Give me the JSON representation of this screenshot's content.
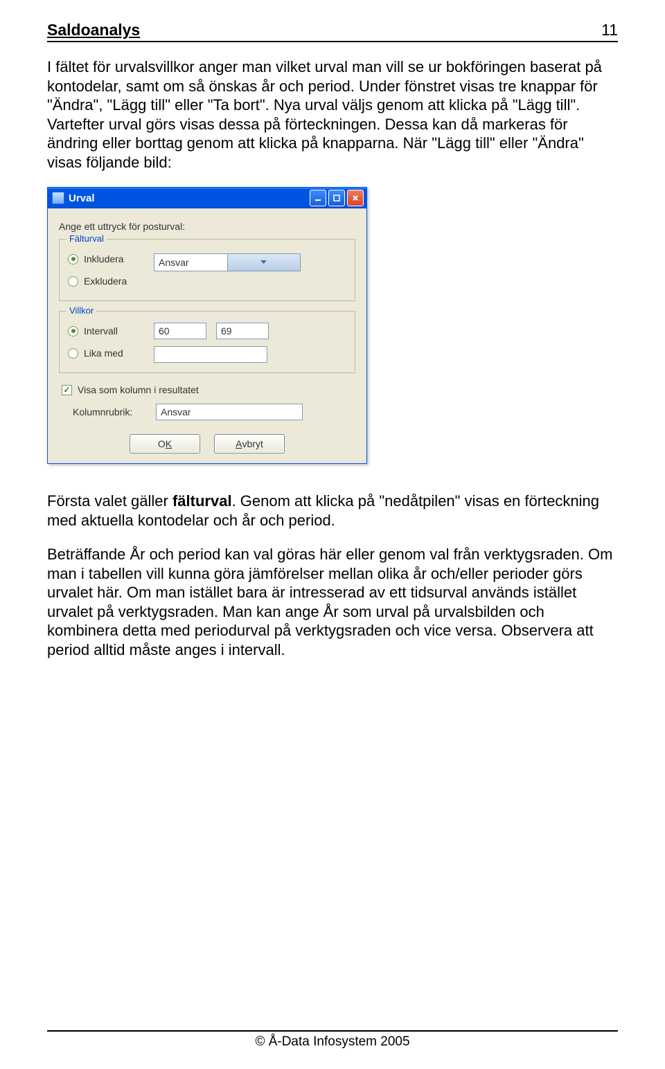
{
  "header": {
    "title": "Saldoanalys",
    "page_number": "11"
  },
  "para1": "I fältet för urvalsvillkor anger man vilket urval man vill se ur bokföringen baserat på kontodelar, samt om så önskas år och period. Under fönstret visas tre knappar för \"Ändra\", \"Lägg till\" eller \"Ta bort\". Nya urval väljs genom att klicka på \"Lägg till\". Vartefter urval görs visas dessa på förteckningen. Dessa kan då markeras för ändring eller borttag genom att klicka på knapparna. När \"Lägg till\" eller \"Ändra\" visas följande bild:",
  "dialog": {
    "title": "Urval",
    "prompt": "Ange ett uttryck för posturval:",
    "group_falturval": {
      "legend": "Fälturval",
      "opt_include": "Inkludera",
      "opt_exclude": "Exkludera",
      "combo_value": "Ansvar"
    },
    "group_villkor": {
      "legend": "Villkor",
      "opt_intervall": "Intervall",
      "opt_lika": "Lika med",
      "val_from": "60",
      "val_to": "69",
      "val_equal": ""
    },
    "checkbox_label": "Visa som kolumn i resultatet",
    "kolumn_label": "Kolumnrubrik:",
    "kolumn_value": "Ansvar",
    "btn_ok_pre": "O",
    "btn_ok_u": "K",
    "btn_cancel_u": "A",
    "btn_cancel_post": "vbryt"
  },
  "para2_pre": "Första valet gäller ",
  "para2_bold": "fälturval",
  "para2_post": ". Genom att klicka på \"nedåtpilen\" visas en förteckning med aktuella kontodelar och år och period.",
  "para3": "Beträffande År och period kan val göras här eller genom val från verktygsraden. Om man i tabellen vill kunna göra jämförelser mellan olika år och/eller perioder görs urvalet här. Om man istället bara är intresserad av ett tidsurval används istället urvalet på verktygsraden. Man kan ange År som urval på urvalsbilden och kombinera detta med periodurval på verktygsraden och vice versa. Observera att period alltid måste anges i intervall.",
  "footer": "© Å-Data Infosystem 2005"
}
